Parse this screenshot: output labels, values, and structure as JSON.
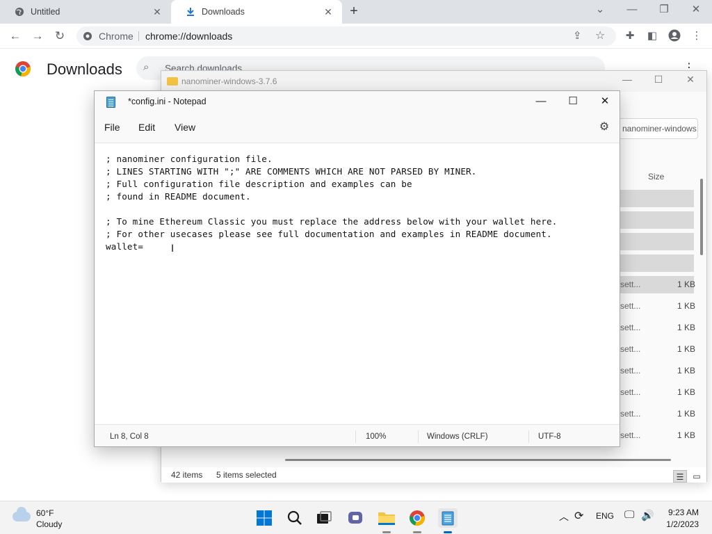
{
  "browser": {
    "tabs": [
      {
        "label": "Untitled"
      },
      {
        "label": "Downloads"
      }
    ],
    "omnibox": {
      "site": "Chrome",
      "url": "chrome://downloads"
    },
    "page_title": "Downloads",
    "search_placeholder": "Search downloads"
  },
  "explorer": {
    "title": "nanominer-windows-3.7.6",
    "address": "nanominer-windows...",
    "size_header": "Size",
    "rows": [
      {
        "name": "",
        "size": "",
        "selected": true
      },
      {
        "name": "",
        "size": "",
        "selected": true
      },
      {
        "name": "",
        "size": "",
        "selected": true
      },
      {
        "name": "",
        "size": "",
        "selected": true
      },
      {
        "name": "sett...",
        "size": "1 KB",
        "selected": true
      },
      {
        "name": "sett...",
        "size": "1 KB",
        "selected": false
      },
      {
        "name": "sett...",
        "size": "1 KB",
        "selected": false
      },
      {
        "name": "sett...",
        "size": "1 KB",
        "selected": false
      },
      {
        "name": "sett...",
        "size": "1 KB",
        "selected": false
      },
      {
        "name": "sett...",
        "size": "1 KB",
        "selected": false
      },
      {
        "name": "sett...",
        "size": "1 KB",
        "selected": false
      },
      {
        "name": "sett...",
        "size": "1 KB",
        "selected": false
      }
    ],
    "status": {
      "items": "42 items",
      "selected": "5 items selected"
    }
  },
  "notepad": {
    "title": "*config.ini - Notepad",
    "menu": {
      "file": "File",
      "edit": "Edit",
      "view": "View"
    },
    "lines": [
      "; nanominer configuration file.",
      "; LINES STARTING WITH \";\" ARE COMMENTS WHICH ARE NOT PARSED BY MINER.",
      "; Full configuration file description and examples can be",
      "; found in README document.",
      "",
      "; To mine Ethereum Classic you must replace the address below with your wallet here.",
      "; For other usecases please see full documentation and examples in README document.",
      "wallet="
    ],
    "status": {
      "position": "Ln 8, Col 8",
      "zoom": "100%",
      "line_ending": "Windows (CRLF)",
      "encoding": "UTF-8"
    }
  },
  "taskbar": {
    "weather": {
      "temp": "60°F",
      "desc": "Cloudy"
    },
    "language": "ENG",
    "time": "9:23 AM",
    "date": "1/2/2023",
    "apps": [
      "windows-start",
      "search",
      "task-view",
      "chat",
      "file-explorer",
      "chrome",
      "notepad"
    ]
  }
}
